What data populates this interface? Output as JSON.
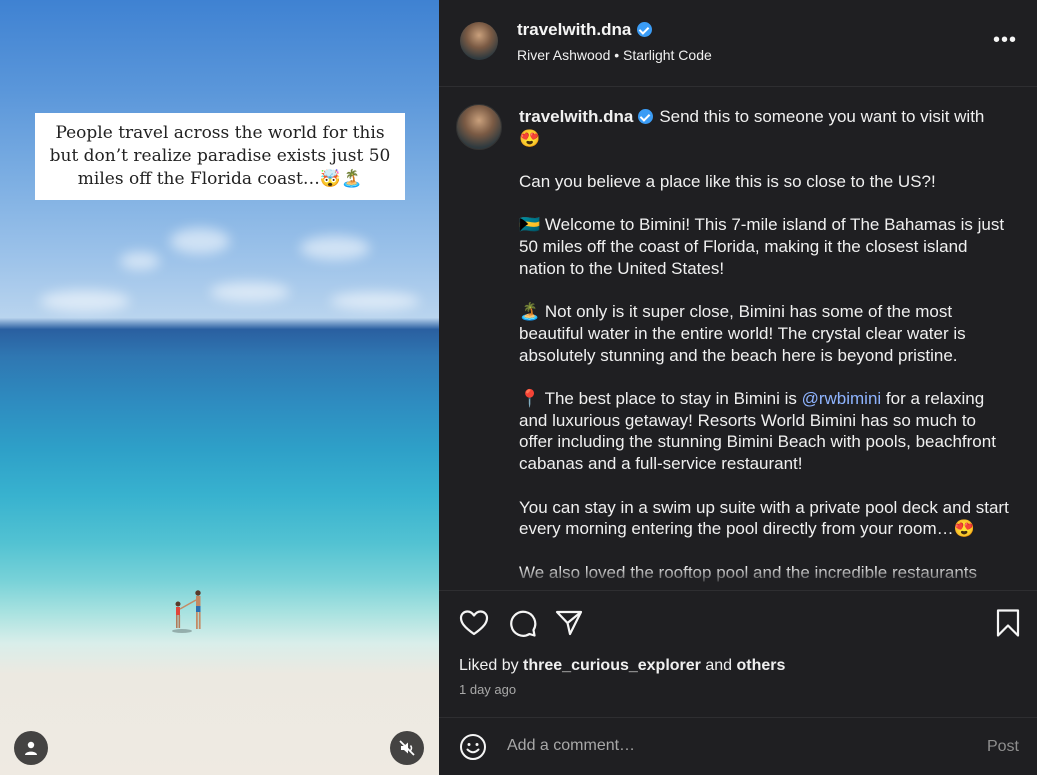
{
  "media": {
    "overlay_caption": "People travel across the world for this but don’t realize paradise exists just 50 miles off the Florida coast…🤯🏝️",
    "user_tag_icon": "person-icon",
    "mute_icon": "muted-speaker-icon"
  },
  "header": {
    "username": "travelwith.dna",
    "subtitle": "River Ashwood • Starlight Code",
    "more_label": "•••"
  },
  "caption": {
    "username": "travelwith.dna",
    "intro": "Send this to someone you want to visit with 😍",
    "p1": "Can you believe a place like this is so close to the US?!",
    "p2": "🇧🇸 Welcome to Bimini! This 7-mile island of The Bahamas is just 50 miles off the coast of Florida, making it the closest island nation to the United States!",
    "p3": "🏝️ Not only is it super close, Bimini has some of the most beautiful water in the entire world! The crystal clear water is absolutely stunning and the beach here is beyond pristine.",
    "p4_before": "📍 The best place to stay in Bimini is ",
    "p4_mention": "@rwbimini",
    "p4_after": " for a relaxing and luxurious getaway! Resorts World Bimini has so much to offer including the stunning Bimini Beach with pools, beachfront cabanas and a full-service restaurant!",
    "p5": "You can stay in a swim up suite with a private pool deck and start every morning entering the pool directly from your room…😍",
    "p6": "We also loved the rooftop pool and the incredible restaurants"
  },
  "likes": {
    "prefix": "Liked by ",
    "user": "three_curious_explorer",
    "middle": " and ",
    "others": "others",
    "time_ago": "1 day ago"
  },
  "comment": {
    "placeholder": "Add a comment…",
    "post_label": "Post"
  },
  "colors": {
    "panel_bg": "#1f1f22",
    "verified": "#3b9cf5",
    "mention": "#8fb4ff",
    "muted_text": "#a8a8a8"
  }
}
